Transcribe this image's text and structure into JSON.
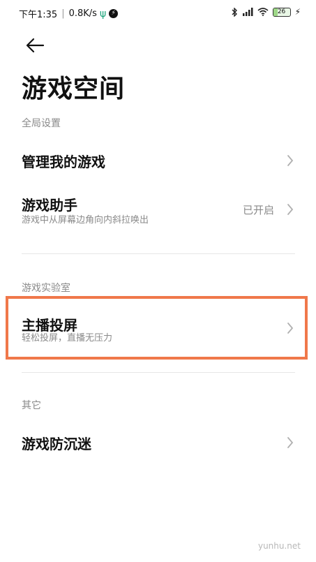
{
  "status_bar": {
    "time": "下午1:35",
    "speed": "0.8K/s",
    "battery_level": "26",
    "icons": [
      "usb-icon",
      "lightning-circle-icon",
      "bluetooth-icon",
      "signal-icon",
      "wifi-icon",
      "battery-icon",
      "charging-icon"
    ]
  },
  "header": {
    "title": "游戏空间"
  },
  "sections": {
    "global": {
      "heading": "全局设置",
      "manage_games": {
        "title": "管理我的游戏"
      },
      "game_assistant": {
        "title": "游戏助手",
        "subtitle": "游戏中从屏幕边角向内斜拉唤出",
        "value": "已开启"
      }
    },
    "lab": {
      "heading": "游戏实验室",
      "streamer_cast": {
        "title": "主播投屏",
        "subtitle": "轻松投屏，直播无压力"
      }
    },
    "other": {
      "heading": "其它",
      "anti_addiction": {
        "title": "游戏防沉迷"
      }
    }
  },
  "highlight_color": "#f0784a",
  "watermark": "yunhu.net"
}
